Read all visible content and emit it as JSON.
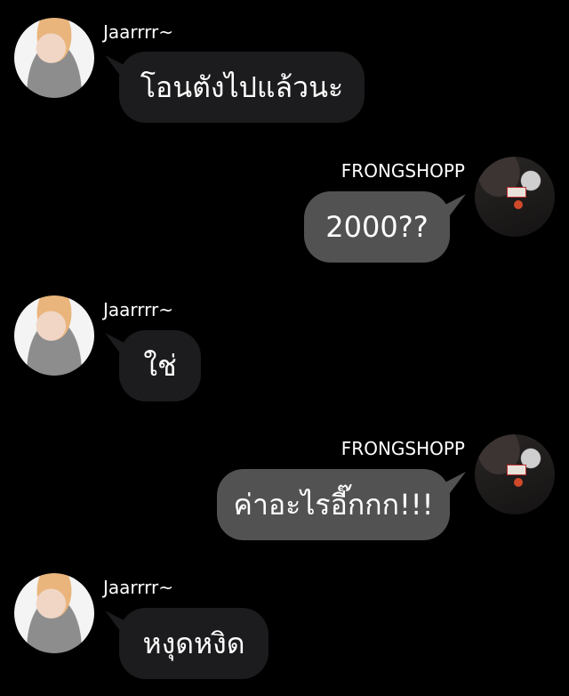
{
  "messages": [
    {
      "sender": "Jaarrrr~",
      "side": "left",
      "text": "โอนตังไปแล้วนะ",
      "avatar_icon": "profile-photo"
    },
    {
      "sender": "FRONGSHOPP",
      "side": "right",
      "text": "2000??",
      "avatar_icon": "profile-photo"
    },
    {
      "sender": "Jaarrrr~",
      "side": "left",
      "text": "ใช่",
      "avatar_icon": "profile-photo"
    },
    {
      "sender": "FRONGSHOPP",
      "side": "right",
      "text": "ค่าอะไรอี๊กกก!!!",
      "avatar_icon": "profile-photo"
    },
    {
      "sender": "Jaarrrr~",
      "side": "left",
      "text": "หงุดหงิด",
      "avatar_icon": "profile-photo"
    }
  ],
  "colors": {
    "background": "#000000",
    "incoming_bubble": "#1c1c1e",
    "outgoing_bubble": "#525252",
    "text": "#ffffff"
  }
}
